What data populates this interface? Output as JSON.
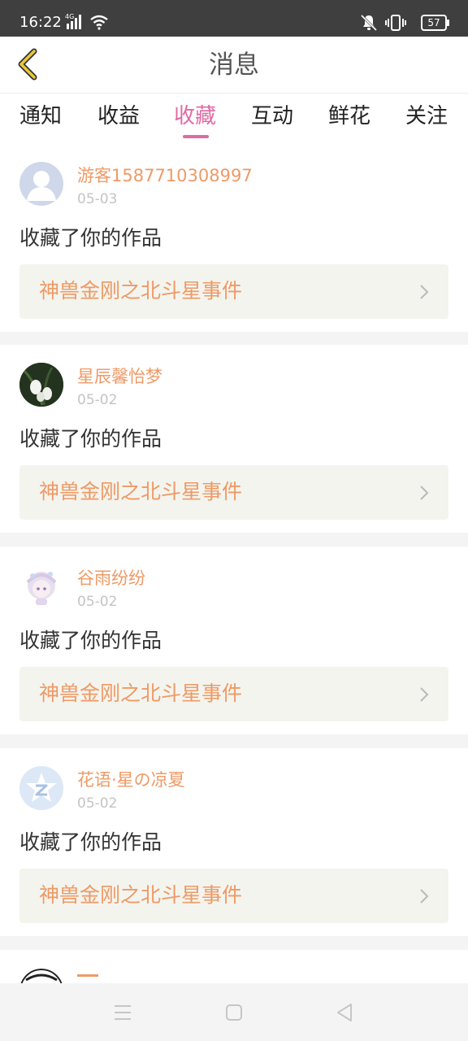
{
  "status_bar": {
    "time": "16:22",
    "network": "4G",
    "battery": "57"
  },
  "header": {
    "title": "消息",
    "back_icon": "chevron-left-icon",
    "accent_color": "#e8c93a"
  },
  "tabs": [
    {
      "label": "通知",
      "active": false
    },
    {
      "label": "收益",
      "active": false
    },
    {
      "label": "收藏",
      "active": true
    },
    {
      "label": "互动",
      "active": false
    },
    {
      "label": "鲜花",
      "active": false
    },
    {
      "label": "关注",
      "active": false
    }
  ],
  "theme": {
    "active_tab_color": "#e06aa3",
    "username_color": "#ee9a66",
    "work_title_color": "#ee9a66",
    "work_box_bg": "#f4f4ee"
  },
  "messages": [
    {
      "username": "游客1587710308997",
      "date": "05-03",
      "action": "收藏了你的作品",
      "work_title": "神兽金刚之北斗星事件",
      "avatar": "default-user-avatar"
    },
    {
      "username": "星辰馨怡梦",
      "date": "05-02",
      "action": "收藏了你的作品",
      "work_title": "神兽金刚之北斗星事件",
      "avatar": "flower-photo-avatar"
    },
    {
      "username": "谷雨纷纷",
      "date": "05-02",
      "action": "收藏了你的作品",
      "work_title": "神兽金刚之北斗星事件",
      "avatar": "anime-girl-avatar"
    },
    {
      "username": "花语·星の凉夏",
      "date": "05-02",
      "action": "收藏了你的作品",
      "work_title": "神兽金刚之北斗星事件",
      "avatar": "qzone-star-avatar"
    }
  ],
  "nav_bar": {
    "menu_icon": "menu-icon",
    "home_icon": "home-square-icon",
    "back_icon": "back-triangle-icon"
  }
}
